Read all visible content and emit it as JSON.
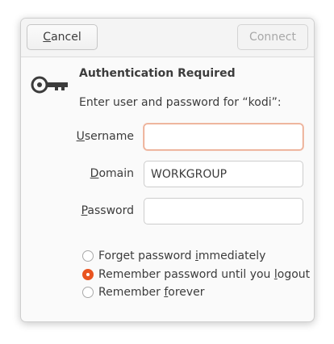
{
  "header": {
    "cancel_label": "Cancel",
    "cancel_mnemonic": "C",
    "cancel_rest": "ancel",
    "connect_label": "Connect"
  },
  "dialog": {
    "title": "Authentication Required",
    "subtitle": "Enter user and password for “kodi”:"
  },
  "form": {
    "username": {
      "mnemonic": "U",
      "rest": "sername",
      "value": ""
    },
    "domain": {
      "pre": "",
      "mnemonic": "D",
      "rest": "omain",
      "value": "WORKGROUP"
    },
    "password": {
      "mnemonic": "P",
      "rest": "assword",
      "value": ""
    }
  },
  "options": [
    {
      "pre": "Forget password ",
      "mnemonic": "i",
      "post": "mmediately",
      "checked": false
    },
    {
      "pre": "Remember password until you ",
      "mnemonic": "l",
      "post": "ogout",
      "checked": true
    },
    {
      "pre": "Remember ",
      "mnemonic": "f",
      "post": "orever",
      "checked": false
    }
  ],
  "colors": {
    "accent": "#e95420",
    "focus_border": "#e9a184"
  },
  "icons": {
    "auth": "key-icon"
  }
}
